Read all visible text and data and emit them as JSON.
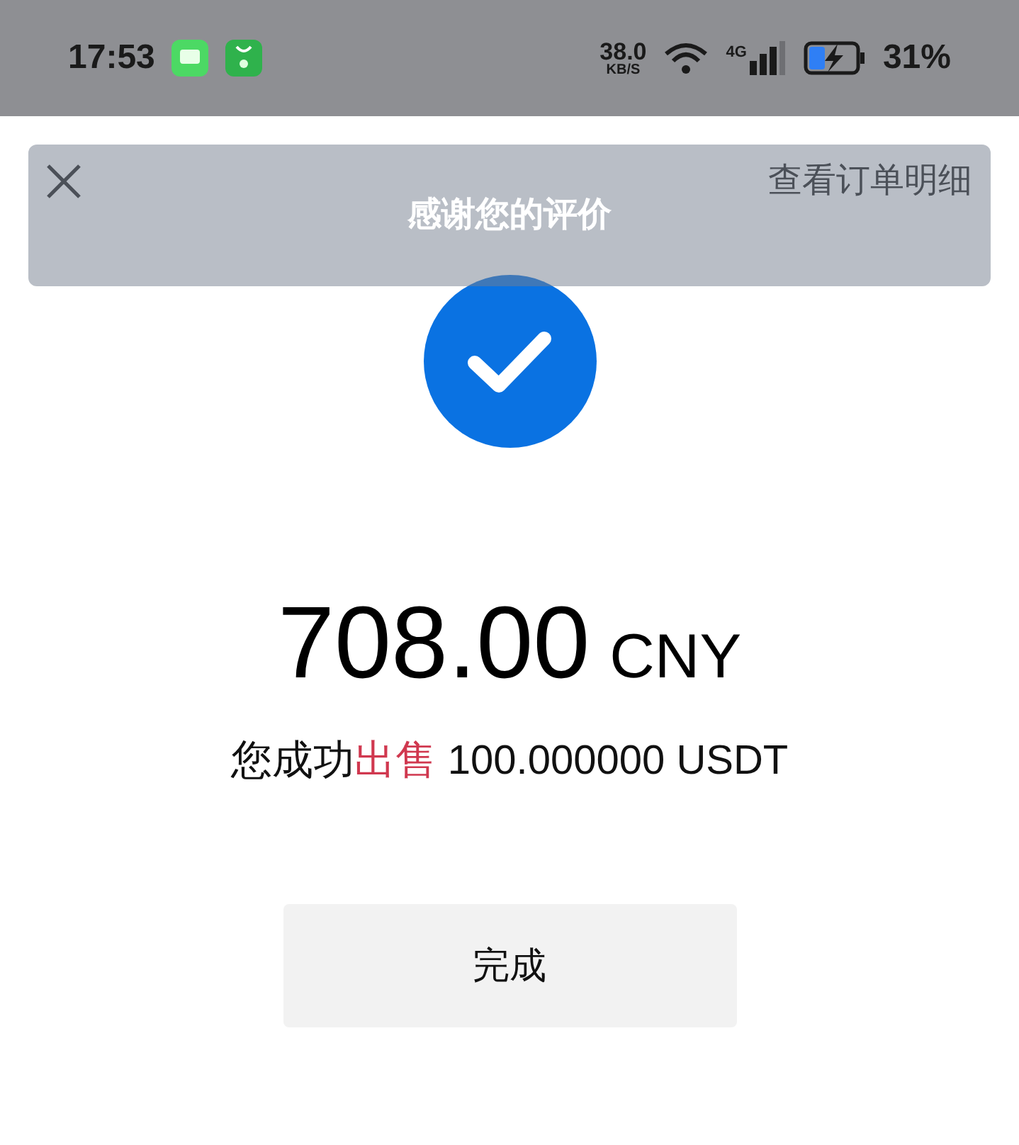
{
  "status_bar": {
    "time": "17:53",
    "speed_value": "38.0",
    "speed_unit": "KB/S",
    "network": "4G",
    "battery": "31%"
  },
  "header": {
    "link": "查看订单明细"
  },
  "toast": {
    "text": "感谢您的评价"
  },
  "result": {
    "amount": "708.00",
    "currency": "CNY",
    "prefix": "您成功",
    "action": "出售",
    "quantity": "100.000000 USDT"
  },
  "done_button": "完成"
}
